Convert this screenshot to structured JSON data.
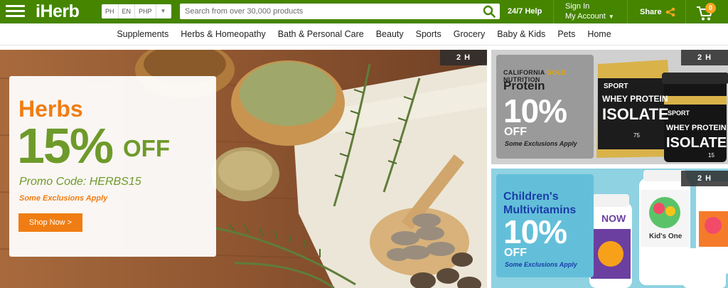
{
  "header": {
    "logo": "iHerb",
    "locale": {
      "country": "PH",
      "language": "EN",
      "currency": "PHP"
    },
    "search": {
      "placeholder": "Search from over 30,000 products"
    },
    "help_label": "24/7 Help",
    "sign_in_label": "Sign In",
    "account_label": "My Account",
    "share_label": "Share",
    "cart_count": "0",
    "colors": {
      "brand_green": "#458500",
      "accent_orange": "#f5a623"
    }
  },
  "nav": {
    "categories": [
      "Supplements",
      "Herbs & Homeopathy",
      "Bath & Personal Care",
      "Beauty",
      "Sports",
      "Grocery",
      "Baby & Kids",
      "Pets",
      "Home"
    ]
  },
  "hero": {
    "title": "Herbs",
    "percent": "15%",
    "off": "OFF",
    "promo_code": "Promo Code: HERBS15",
    "exclusions": "Some Exclusions Apply",
    "button_label": "Shop Now  >",
    "tag": "2 H"
  },
  "promos": [
    {
      "brand_prefix": "CALIFORNIA",
      "brand_gold": "GOLD",
      "brand_suffix": "NUTRITION",
      "product": "Protein",
      "percent": "10%",
      "off": "OFF",
      "exclusions": "Some Exclusions Apply",
      "tag": "2 H",
      "pack_texts": [
        "SPORT",
        "WHEY PROTEIN",
        "ISOLATE",
        "75",
        "15"
      ]
    },
    {
      "product": "Children's Multivitamins",
      "percent": "10%",
      "off": "OFF",
      "exclusions": "Some Exclusions Apply",
      "tag": "2 H",
      "bottle_texts": [
        "NOW",
        "Kid's One"
      ]
    }
  ]
}
